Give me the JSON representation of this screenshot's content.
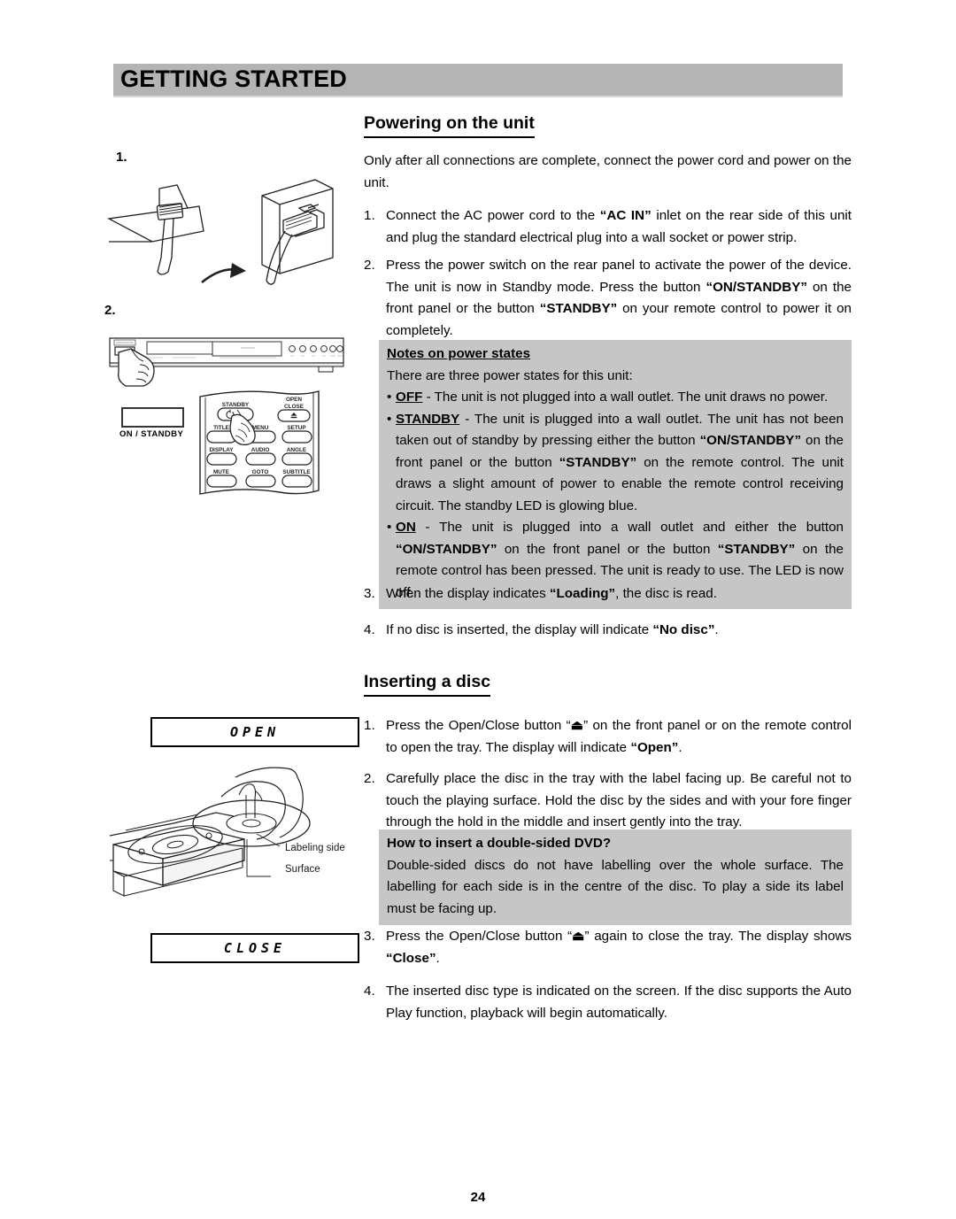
{
  "chapter": {
    "title": "GETTING STARTED",
    "bar_color": "#b4b4b4"
  },
  "sections": {
    "powering": {
      "heading": "Powering on the unit"
    },
    "inserting": {
      "heading": "Inserting a disc"
    }
  },
  "powering": {
    "intro": "Only after all connections are complete, connect the power cord and power on the unit.",
    "steps": [
      {
        "num": "1.",
        "text_a": "Connect the AC power cord to the ",
        "bold_a": "“AC IN”",
        "text_b": "  inlet on the rear side of this unit and plug the standard electrical plug into a wall socket or power strip."
      },
      {
        "num": "2.",
        "text_a": "Press the power switch on the rear panel to activate the power of the device. The unit is now in Standby mode. Press the button ",
        "bold_a": "“ON/STANDBY”",
        "text_b": " on the front panel or the button ",
        "bold_b": "“STANDBY”",
        "text_c": " on your remote control to power it on completely."
      },
      {
        "num": "3.",
        "text_a": "When the display indicates ",
        "bold_a": "“Loading”",
        "text_b": ", the disc is read."
      },
      {
        "num": "4.",
        "text_a": "If no disc is inserted, the display will indicate ",
        "bold_a": "“No disc”",
        "text_b": "."
      }
    ],
    "note": {
      "title": "Notes on power states",
      "lead": "There are three power states for this unit:",
      "bullets": [
        {
          "dot": "•",
          "label": "OFF",
          "text_a": " - The unit is not plugged into a wall outlet. The unit draws no power."
        },
        {
          "dot": "•",
          "label": "STANDBY",
          "text_a": " - The unit is plugged into a wall outlet. The unit has not been taken out of standby by pressing either the button ",
          "bold_a": "“ON/STANDBY”",
          "text_b": " on the front panel or the button ",
          "bold_b": "“STANDBY”",
          "text_c": " on the remote control. The unit draws a slight amount of power to enable the remote control receiving circuit. The standby LED is glowing blue."
        },
        {
          "dot": "•",
          "label": "ON",
          "text_a": " - The unit is plugged into a wall outlet and either the button ",
          "bold_a": "“ON/STANDBY”",
          "text_b": " on the front panel or the button ",
          "bold_b": "“STANDBY”",
          "text_c": " on the remote control has been pressed. The unit is ready to use. The LED is now off."
        }
      ]
    }
  },
  "inserting": {
    "steps": [
      {
        "num": "1.",
        "text_a": "Press the Open/Close button “",
        "glyph": "⏏",
        "text_b": "” on the front panel or on the remote control to open the tray. The display will indicate ",
        "bold_a": "“Open”",
        "text_c": "."
      },
      {
        "num": "2.",
        "text_a": "Carefully place the disc in the tray with the label facing up. Be careful not to touch the playing surface. Hold the disc by the sides and with your fore finger through the hold in the middle and insert gently into the tray."
      },
      {
        "num": "3.",
        "text_a": "Press the Open/Close button “",
        "glyph": "⏏",
        "text_b": "” again to close the tray. The display shows ",
        "bold_a": "“Close”",
        "text_c": "."
      },
      {
        "num": "4.",
        "text_a": "The inserted disc type is indicated on the screen. If the disc supports the Auto Play function, playback will begin automatically."
      }
    ],
    "note": {
      "title": "How to insert a double-sided DVD?",
      "body": "Double-sided discs do not have labelling over the whole surface. The labelling for each side is in the centre of the disc. To play a side its label must be facing up."
    }
  },
  "figures": {
    "step1_label": "1.",
    "step2_label": "2.",
    "front_panel_button_label": "ON / STANDBY",
    "remote_buttons": {
      "standby": "STANDBY",
      "open": "OPEN",
      "close": "CLOSE",
      "title": "TITLE",
      "menu": "MENU",
      "setup": "SETUP",
      "display": "DISPLAY",
      "audio": "AUDIO",
      "angle": "ANGLE",
      "mute": "MUTE",
      "goto": "GOTO",
      "subtitle": "SUBTITLE"
    },
    "lcd_open": "OPEN",
    "lcd_close": "CLOSE",
    "disc_callouts": {
      "labeling_side": "Labeling side",
      "surface": "Surface"
    }
  },
  "footer": {
    "page_number": "24"
  }
}
